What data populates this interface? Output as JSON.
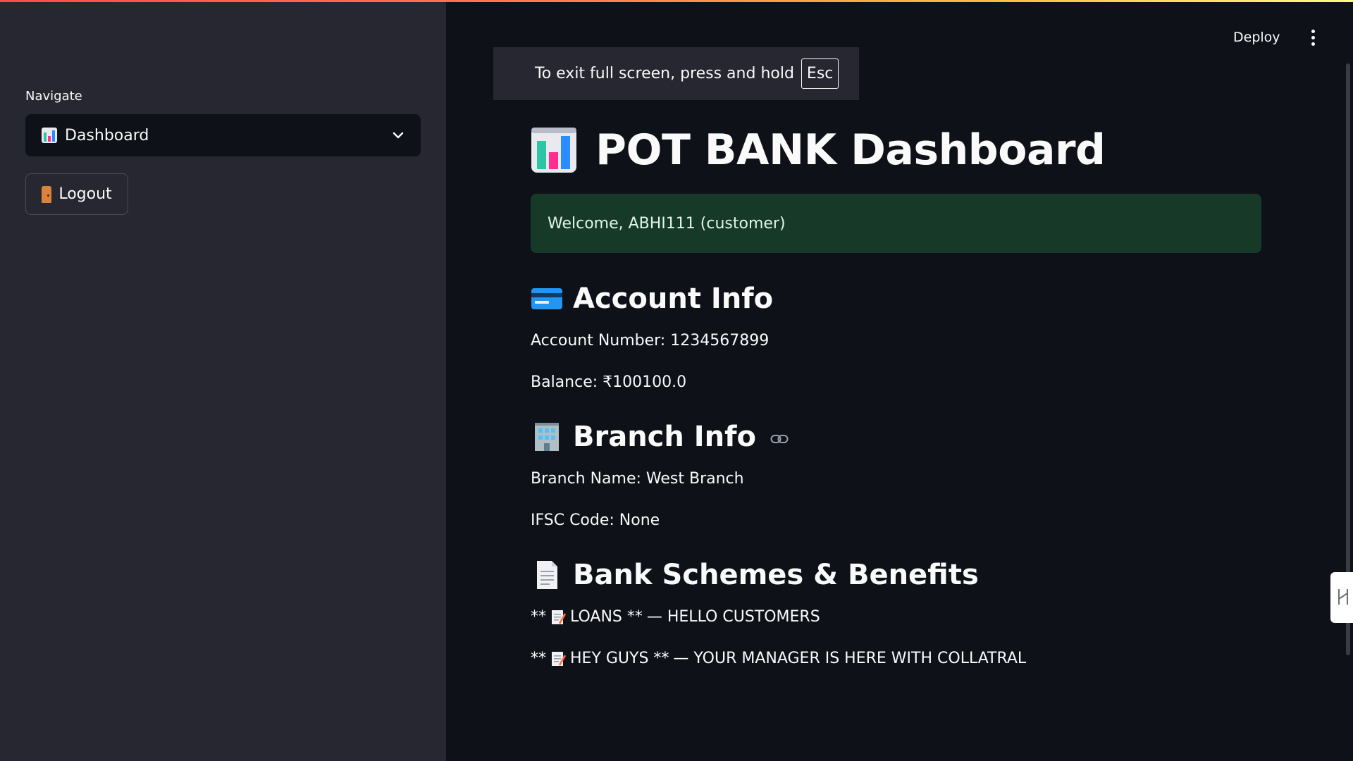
{
  "sidebar": {
    "nav_label": "Navigate",
    "selected_page": "Dashboard",
    "logout_label": "Logout"
  },
  "header": {
    "deploy_label": "Deploy"
  },
  "fullscreen_notice": {
    "text": "To exit full screen, press and hold",
    "key": "Esc"
  },
  "main": {
    "title": "POT BANK Dashboard",
    "welcome": "Welcome, ABHI111 (customer)",
    "account": {
      "heading": "Account Info",
      "account_number": "Account Number: 1234567899",
      "balance": "Balance: ₹100100.0"
    },
    "branch": {
      "heading": "Branch Info",
      "name": "Branch Name: West Branch",
      "ifsc": "IFSC Code: None"
    },
    "schemes": {
      "heading": "Bank Schemes & Benefits",
      "items": [
        {
          "prefix": "**",
          "title": "LOANS **",
          "desc": "— HELLO CUSTOMERS"
        },
        {
          "prefix": "**",
          "title": "HEY GUYS **",
          "desc": "— YOUR MANAGER IS HERE WITH COLLATRAL"
        }
      ]
    }
  },
  "colors": {
    "background": "#0e1117",
    "sidebar": "#262730",
    "success_bg": "#173928",
    "accent_stripe": "#ff4b4b"
  },
  "icons": {
    "title": "bar-chart-icon",
    "account": "credit-card-icon",
    "branch": "office-building-icon",
    "schemes": "document-icon",
    "logout": "door-icon",
    "scheme_item": "memo-icon"
  }
}
